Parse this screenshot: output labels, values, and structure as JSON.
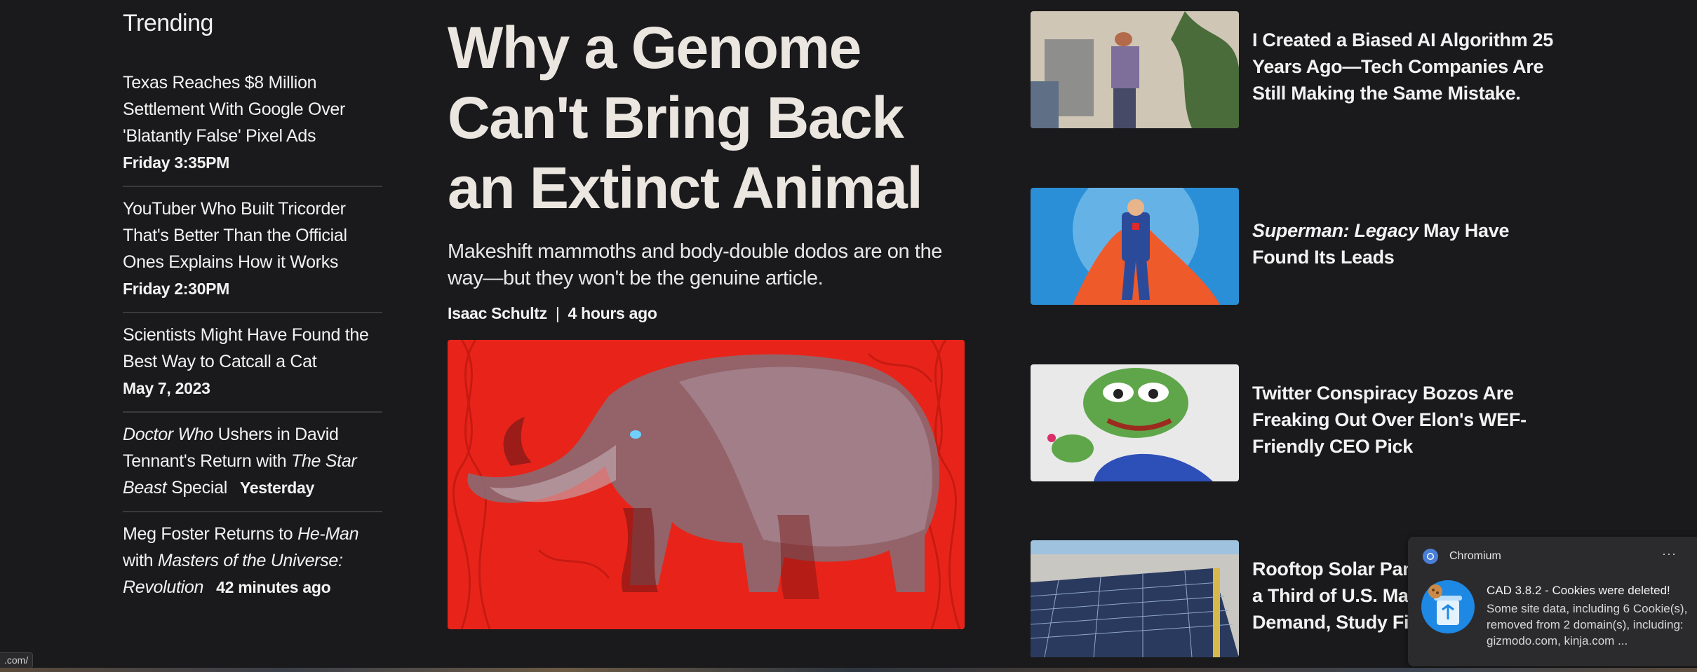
{
  "trending": {
    "heading": "Trending",
    "items": [
      {
        "title": "Texas Reaches $8 Million Settlement With Google Over 'Blatantly False' Pixel Ads",
        "time": "Friday 3:35PM"
      },
      {
        "title": "YouTuber Who Built Tricorder That's Better Than the Official Ones Explains How it Works",
        "time": "Friday 2:30PM"
      },
      {
        "title": "Scientists Might Have Found the Best Way to Catcall a Cat",
        "time": "May 7, 2023"
      },
      {
        "title_parts": [
          "Doctor Who",
          " Ushers in David Tennant's Return with ",
          "The Star Beast",
          " Special"
        ],
        "time": "Yesterday"
      },
      {
        "title_parts": [
          "Meg Foster Returns to ",
          "He-Man",
          " with ",
          "Masters of the Universe: Revolution"
        ],
        "time": "42 minutes ago"
      }
    ]
  },
  "main": {
    "title": "Why a Genome Can't Bring Back an Extinct Animal",
    "dek": "Makeshift mammoths and body-double dodos are on the way—but they won't be the genuine article.",
    "author": "Isaac Schultz",
    "separator": "|",
    "time": "4 hours ago"
  },
  "side": {
    "items": [
      {
        "title": "I Created a Biased AI Algorithm 25 Years Ago—Tech Companies Are Still Making the Same Mistake."
      },
      {
        "title_italic": "Superman: Legacy",
        "title_rest": " May Have Found Its Leads"
      },
      {
        "title": "Twitter Conspiracy Bozos Are Freaking Out Over Elon's WEF-Friendly CEO Pick"
      },
      {
        "title": "Rooftop Solar Panels Could Cover a Third of U.S. Manufacturing Demand, Study Finds"
      }
    ]
  },
  "notification": {
    "app": "Chromium",
    "more": "···",
    "title": "CAD 3.8.2 - Cookies were deleted!",
    "body": "Some site data, including 6 Cookie(s), removed from 2 domain(s), including: gizmodo.com, kinja.com ..."
  },
  "status_bar": {
    "url": ".com/"
  },
  "colors": {
    "background": "#1a1a1c",
    "hero_red": "#e8241a",
    "text": "#f2f2f2"
  }
}
